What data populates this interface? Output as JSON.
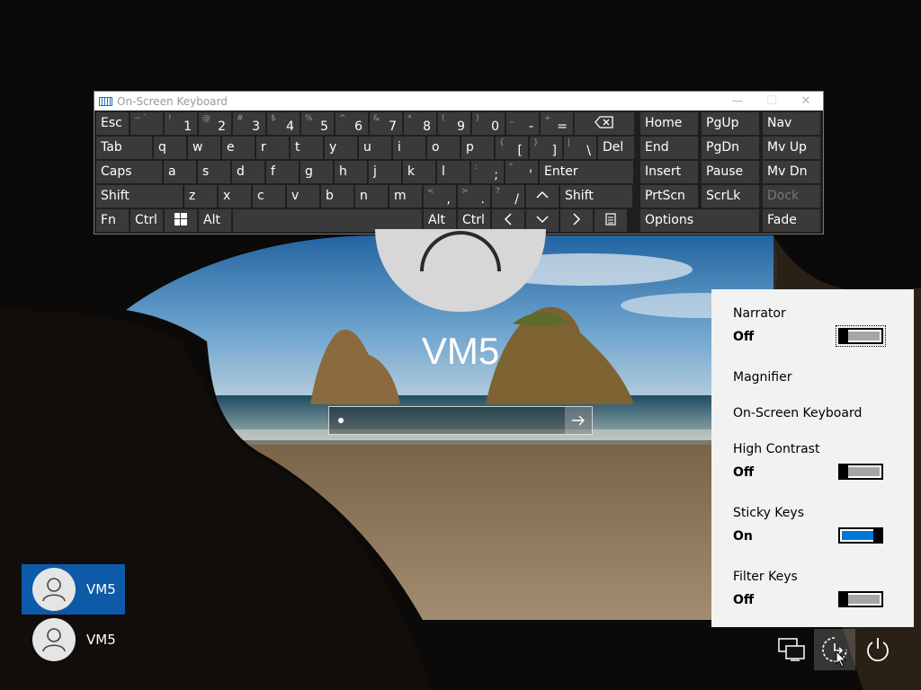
{
  "osk": {
    "title": "On-Screen Keyboard",
    "window_buttons": [
      "—",
      "☐",
      "✕"
    ],
    "rows": [
      [
        {
          "k": "esc",
          "t": "Esc"
        },
        {
          "k": "tilde",
          "s": "~ `",
          "m": ""
        },
        {
          "k": "1",
          "s": "!",
          "m": "1"
        },
        {
          "k": "2",
          "s": "@",
          "m": "2"
        },
        {
          "k": "3",
          "s": "#",
          "m": "3"
        },
        {
          "k": "4",
          "s": "$",
          "m": "4"
        },
        {
          "k": "5",
          "s": "%",
          "m": "5"
        },
        {
          "k": "6",
          "s": "^",
          "m": "6"
        },
        {
          "k": "7",
          "s": "&",
          "m": "7"
        },
        {
          "k": "8",
          "s": "*",
          "m": "8"
        },
        {
          "k": "9",
          "s": "(",
          "m": "9"
        },
        {
          "k": "0",
          "s": ")",
          "m": "0"
        },
        {
          "k": "minus",
          "s": "_",
          "m": "-"
        },
        {
          "k": "equals",
          "s": "+",
          "m": "="
        },
        {
          "k": "backspace",
          "icon": "backspace"
        }
      ],
      [
        {
          "k": "tab",
          "t": "Tab"
        },
        {
          "k": "q",
          "t": "q"
        },
        {
          "k": "w",
          "t": "w"
        },
        {
          "k": "e",
          "t": "e"
        },
        {
          "k": "r",
          "t": "r"
        },
        {
          "k": "t",
          "t": "t"
        },
        {
          "k": "y",
          "t": "y"
        },
        {
          "k": "u",
          "t": "u"
        },
        {
          "k": "i",
          "t": "i"
        },
        {
          "k": "o",
          "t": "o"
        },
        {
          "k": "p",
          "t": "p"
        },
        {
          "k": "lbracket",
          "s": "{",
          "m": "["
        },
        {
          "k": "rbracket",
          "s": "}",
          "m": "]"
        },
        {
          "k": "backslash",
          "s": "|",
          "m": "\\"
        },
        {
          "k": "del",
          "t": "Del"
        }
      ],
      [
        {
          "k": "caps",
          "t": "Caps"
        },
        {
          "k": "a",
          "t": "a"
        },
        {
          "k": "s",
          "t": "s"
        },
        {
          "k": "d",
          "t": "d"
        },
        {
          "k": "f",
          "t": "f"
        },
        {
          "k": "g",
          "t": "g"
        },
        {
          "k": "h",
          "t": "h"
        },
        {
          "k": "j",
          "t": "j"
        },
        {
          "k": "k",
          "t": "k"
        },
        {
          "k": "l",
          "t": "l"
        },
        {
          "k": "semicolon",
          "s": ":",
          "m": ";"
        },
        {
          "k": "quote",
          "s": "\"",
          "m": "'"
        },
        {
          "k": "enter",
          "t": "Enter"
        }
      ],
      [
        {
          "k": "lshift",
          "t": "Shift"
        },
        {
          "k": "z",
          "t": "z"
        },
        {
          "k": "x",
          "t": "x"
        },
        {
          "k": "c",
          "t": "c"
        },
        {
          "k": "v",
          "t": "v"
        },
        {
          "k": "b",
          "t": "b"
        },
        {
          "k": "n",
          "t": "n"
        },
        {
          "k": "m",
          "t": "m"
        },
        {
          "k": "comma",
          "s": "<",
          "m": ","
        },
        {
          "k": "period",
          "s": ">",
          "m": "."
        },
        {
          "k": "slash",
          "s": "?",
          "m": "/"
        },
        {
          "k": "up",
          "icon": "up"
        },
        {
          "k": "rshift",
          "t": "Shift"
        }
      ],
      [
        {
          "k": "fn",
          "t": "Fn"
        },
        {
          "k": "lctrl",
          "t": "Ctrl"
        },
        {
          "k": "win",
          "icon": "windows"
        },
        {
          "k": "lalt",
          "t": "Alt"
        },
        {
          "k": "space",
          "t": ""
        },
        {
          "k": "ralt",
          "t": "Alt"
        },
        {
          "k": "rctrl",
          "t": "Ctrl"
        },
        {
          "k": "left",
          "icon": "left"
        },
        {
          "k": "down",
          "icon": "down"
        },
        {
          "k": "right",
          "icon": "right"
        },
        {
          "k": "menu",
          "icon": "menu"
        }
      ]
    ],
    "nav_keys": [
      {
        "k": "home",
        "t": "Home"
      },
      {
        "k": "pgup",
        "t": "PgUp"
      },
      {
        "k": "nav",
        "t": "Nav"
      },
      {
        "k": "end",
        "t": "End"
      },
      {
        "k": "pgdn",
        "t": "PgDn"
      },
      {
        "k": "mvup",
        "t": "Mv Up"
      },
      {
        "k": "insert",
        "t": "Insert"
      },
      {
        "k": "pause",
        "t": "Pause"
      },
      {
        "k": "mvdn",
        "t": "Mv Dn"
      },
      {
        "k": "prtscn",
        "t": "PrtScn"
      },
      {
        "k": "scrlk",
        "t": "ScrLk"
      },
      {
        "k": "dock",
        "t": "Dock",
        "disabled": true
      },
      {
        "k": "options",
        "t": "Options"
      },
      {
        "k": "fade",
        "t": "Fade"
      }
    ]
  },
  "login": {
    "user_name": "VM5",
    "password_value": "•",
    "submit_icon": "arrow-right-icon"
  },
  "users": [
    {
      "name": "VM5",
      "selected": true
    },
    {
      "name": "VM5",
      "selected": false
    }
  ],
  "ease_of_access": {
    "items": [
      {
        "id": "narrator",
        "label": "Narrator",
        "state": "Off",
        "has_toggle": true,
        "on": false,
        "focused": true
      },
      {
        "id": "magnifier",
        "label": "Magnifier",
        "has_toggle": false
      },
      {
        "id": "osk",
        "label": "On-Screen Keyboard",
        "has_toggle": false
      },
      {
        "id": "high-contrast",
        "label": "High Contrast",
        "state": "Off",
        "has_toggle": true,
        "on": false
      },
      {
        "id": "sticky-keys",
        "label": "Sticky Keys",
        "state": "On",
        "has_toggle": true,
        "on": true
      },
      {
        "id": "filter-keys",
        "label": "Filter Keys",
        "state": "Off",
        "has_toggle": true,
        "on": false
      }
    ]
  },
  "tray": {
    "network_icon": "network-icon",
    "ease_icon": "ease-of-access-icon",
    "power_icon": "power-icon"
  },
  "colors": {
    "accent": "#0078d7",
    "selected_user": "#0d5aa8",
    "key": "#3a3a3a",
    "panel": "#f2f2f2"
  }
}
